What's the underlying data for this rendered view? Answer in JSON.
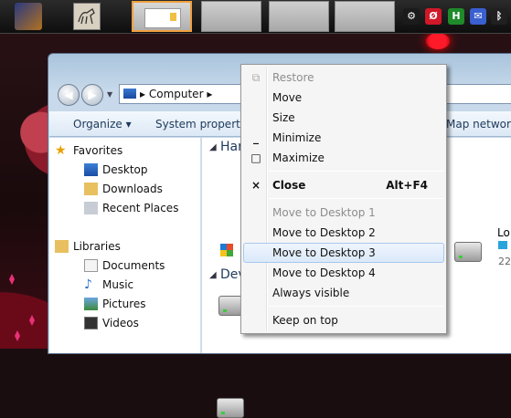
{
  "taskbar": {
    "apps": [
      {
        "name": "app-launcher-icon"
      },
      {
        "name": "horse-sketch-app-icon"
      }
    ],
    "tray": [
      {
        "icon": "steam-icon",
        "glyph": "⚙",
        "color": "#1b1b1b"
      },
      {
        "icon": "red-app-icon",
        "glyph": "Ø",
        "color": "#d01828"
      },
      {
        "icon": "green-app-icon",
        "glyph": "H",
        "color": "#1f8a2a"
      },
      {
        "icon": "mail-icon",
        "glyph": "✉",
        "color": "#3a5fd0"
      },
      {
        "icon": "bluetooth-icon",
        "glyph": "ᛒ",
        "color": "#202020"
      }
    ]
  },
  "explorer": {
    "address_path": "Computer",
    "toolbar": {
      "organize": "Organize ▾",
      "system_properties": "System properties",
      "map_network": "Map network"
    },
    "nav": {
      "favorites": "Favorites",
      "desktop": "Desktop",
      "downloads": "Downloads",
      "recent_places": "Recent Places",
      "libraries": "Libraries",
      "documents": "Documents",
      "music": "Music",
      "pictures": "Pictures",
      "videos": "Videos"
    },
    "groups": {
      "hard_disk": "Har",
      "devices": "Dev",
      "drive_label": "Lo",
      "drive_size": "22"
    }
  },
  "context_menu": {
    "restore": "Restore",
    "move": "Move",
    "size": "Size",
    "minimize": "Minimize",
    "maximize": "Maximize",
    "close": "Close",
    "close_shortcut": "Alt+F4",
    "move_desktop_1": "Move to Desktop 1",
    "move_desktop_2": "Move to Desktop 2",
    "move_desktop_3": "Move to Desktop 3",
    "move_desktop_4": "Move to Desktop 4",
    "always_visible": "Always visible",
    "keep_on_top": "Keep on top"
  }
}
